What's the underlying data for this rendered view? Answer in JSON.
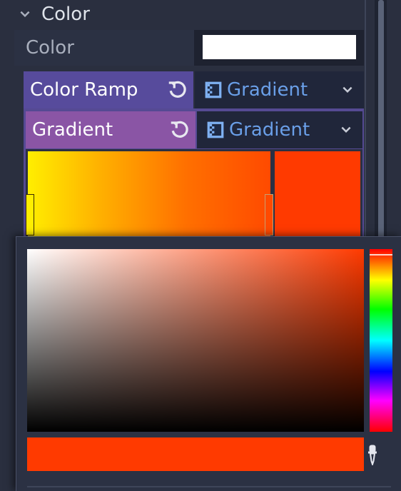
{
  "section": {
    "title": "Color"
  },
  "color_property": {
    "label": "Color",
    "value_color": "#ffffff"
  },
  "color_ramp": {
    "label": "Color Ramp",
    "resource": "Gradient",
    "row_color": "#574b9c"
  },
  "gradient": {
    "label": "Gradient",
    "resource": "Gradient",
    "row_color": "#8a55a5",
    "stops": [
      "#ffee00",
      "#ff4a00"
    ],
    "preview_color": "#ff3a00"
  },
  "picker": {
    "current_color": "#ff3a00",
    "hue_color": "#ff3a00"
  },
  "icons": {
    "collapse": "chevron-down-icon",
    "revert": "revert-icon",
    "resource": "gradient-resource-icon",
    "dropdown": "chevron-down-icon",
    "eyedropper": "eyedropper-icon"
  }
}
